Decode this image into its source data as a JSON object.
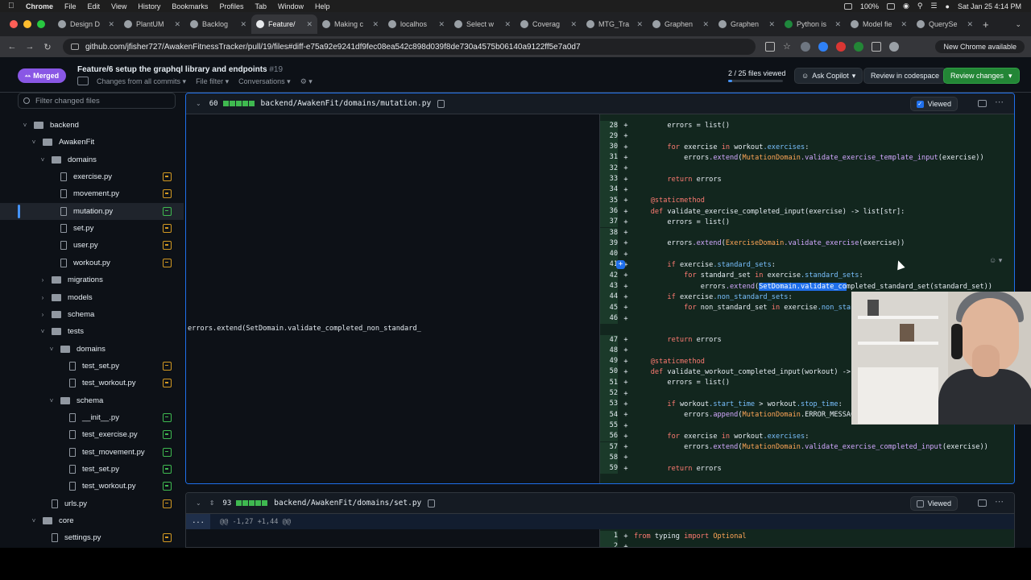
{
  "menubar": {
    "app": "Chrome",
    "items": [
      "File",
      "Edit",
      "View",
      "History",
      "Bookmarks",
      "Profiles",
      "Tab",
      "Window",
      "Help"
    ],
    "battery": "100%",
    "datetime": "Sat Jan 25  4:14 PM"
  },
  "tabs": [
    {
      "label": "Design D",
      "active": false
    },
    {
      "label": "PlantUM",
      "active": false
    },
    {
      "label": "Backlog",
      "active": false
    },
    {
      "label": "Feature/",
      "active": true
    },
    {
      "label": "Making c",
      "active": false
    },
    {
      "label": "localhos",
      "active": false
    },
    {
      "label": "Select w",
      "active": false
    },
    {
      "label": "Coverag",
      "active": false
    },
    {
      "label": "MTG_Tra",
      "active": false
    },
    {
      "label": "Graphen",
      "active": false
    },
    {
      "label": "Graphen",
      "active": false
    },
    {
      "label": "Python is",
      "active": false
    },
    {
      "label": "Model fie",
      "active": false
    },
    {
      "label": "QuerySe",
      "active": false
    }
  ],
  "address": {
    "url": "github.com/jfisher727/AwakenFitnessTracker/pull/19/files#diff-e75a92e9241df9fec08ea542c898d039f8de730a4575b06140a9122ff5e7a0d7",
    "new_chrome": "New Chrome available"
  },
  "pr": {
    "status": "Merged",
    "title": "Feature/6 setup the graphql library and endpoints",
    "number": "#19",
    "changes_filter": "Changes from all commits",
    "file_filter": "File filter",
    "conversations": "Conversations",
    "files_viewed": "2 / 25 files viewed",
    "files_viewed_fraction": 0.08,
    "ask_copilot": "Ask Copilot",
    "review_codespace": "Review in codespace",
    "review_changes": "Review changes"
  },
  "tree": {
    "filter_placeholder": "Filter changed files",
    "rows": [
      {
        "label": "backend",
        "type": "folder",
        "depth": 0,
        "expanded": true
      },
      {
        "label": "AwakenFit",
        "type": "folder",
        "depth": 1,
        "expanded": true
      },
      {
        "label": "domains",
        "type": "folder",
        "depth": 2,
        "expanded": true
      },
      {
        "label": "exercise.py",
        "type": "file",
        "depth": 3,
        "status": "modified"
      },
      {
        "label": "movement.py",
        "type": "file",
        "depth": 3,
        "status": "modified"
      },
      {
        "label": "mutation.py",
        "type": "file",
        "depth": 3,
        "status": "added",
        "selected": true
      },
      {
        "label": "set.py",
        "type": "file",
        "depth": 3,
        "status": "modified"
      },
      {
        "label": "user.py",
        "type": "file",
        "depth": 3,
        "status": "modified"
      },
      {
        "label": "workout.py",
        "type": "file",
        "depth": 3,
        "status": "modified"
      },
      {
        "label": "migrations",
        "type": "folder",
        "depth": 2,
        "expanded": false
      },
      {
        "label": "models",
        "type": "folder",
        "depth": 2,
        "expanded": false
      },
      {
        "label": "schema",
        "type": "folder",
        "depth": 2,
        "expanded": false
      },
      {
        "label": "tests",
        "type": "folder",
        "depth": 2,
        "expanded": true
      },
      {
        "label": "domains",
        "type": "folder",
        "depth": 3,
        "expanded": true
      },
      {
        "label": "test_set.py",
        "type": "file",
        "depth": 4,
        "status": "modified"
      },
      {
        "label": "test_workout.py",
        "type": "file",
        "depth": 4,
        "status": "modified"
      },
      {
        "label": "schema",
        "type": "folder",
        "depth": 3,
        "expanded": true
      },
      {
        "label": "__init__.py",
        "type": "file",
        "depth": 4,
        "status": "added"
      },
      {
        "label": "test_exercise.py",
        "type": "file",
        "depth": 4,
        "status": "added"
      },
      {
        "label": "test_movement.py",
        "type": "file",
        "depth": 4,
        "status": "added"
      },
      {
        "label": "test_set.py",
        "type": "file",
        "depth": 4,
        "status": "added"
      },
      {
        "label": "test_workout.py",
        "type": "file",
        "depth": 4,
        "status": "added"
      },
      {
        "label": "urls.py",
        "type": "file",
        "depth": 2,
        "status": "modified"
      },
      {
        "label": "core",
        "type": "folder",
        "depth": 1,
        "expanded": true
      },
      {
        "label": "settings.py",
        "type": "file",
        "depth": 2,
        "status": "modified"
      }
    ]
  },
  "file1": {
    "count": "60",
    "path": "backend/AwakenFit/domains/mutation.py",
    "viewed_label": "Viewed",
    "lines": [
      {
        "n": "28",
        "code": "        errors = list()"
      },
      {
        "n": "29",
        "code": ""
      },
      {
        "n": "30",
        "code": "        for exercise in workout.exercises:"
      },
      {
        "n": "31",
        "code": "            errors.extend(MutationDomain.validate_exercise_template_input(exercise))"
      },
      {
        "n": "32",
        "code": ""
      },
      {
        "n": "33",
        "code": "        return errors"
      },
      {
        "n": "34",
        "code": ""
      },
      {
        "n": "35",
        "code": "    @staticmethod"
      },
      {
        "n": "36",
        "code": "    def validate_exercise_completed_input(exercise) -> list[str]:"
      },
      {
        "n": "37",
        "code": "        errors = list()"
      },
      {
        "n": "38",
        "code": ""
      },
      {
        "n": "39",
        "code": "        errors.extend(ExerciseDomain.validate_exercise(exercise))"
      },
      {
        "n": "40",
        "code": ""
      },
      {
        "n": "41",
        "code": "        if exercise.standard_sets:"
      },
      {
        "n": "42",
        "code": "            for standard_set in exercise.standard_sets:"
      },
      {
        "n": "43",
        "code": "                errors.extend(SetDomain.validate_completed_standard_set(standard_set))"
      },
      {
        "n": "44",
        "code": "        if exercise.non_standard_sets:"
      },
      {
        "n": "45",
        "code": "            for non_standard_set in exercise.non_standard"
      },
      {
        "n": "46",
        "code": ""
      },
      {
        "n": "47",
        "code": "        return errors"
      },
      {
        "n": "48",
        "code": ""
      },
      {
        "n": "49",
        "code": "    @staticmethod"
      },
      {
        "n": "50",
        "code": "    def validate_workout_completed_input(workout) -> list"
      },
      {
        "n": "51",
        "code": "        errors = list()"
      },
      {
        "n": "52",
        "code": ""
      },
      {
        "n": "53",
        "code": "        if workout.start_time > workout.stop_time:"
      },
      {
        "n": "54",
        "code": "            errors.append(MutationDomain.ERROR_MESSAGES["
      },
      {
        "n": "55",
        "code": ""
      },
      {
        "n": "56",
        "code": "        for exercise in workout.exercises:"
      },
      {
        "n": "57",
        "code": "            errors.extend(MutationDomain.validate_exercise_completed_input(exercise))"
      },
      {
        "n": "58",
        "code": ""
      },
      {
        "n": "59",
        "code": "        return errors"
      }
    ],
    "wrapped_line": "errors.extend(SetDomain.validate_completed_non_standard_"
  },
  "file2": {
    "count": "93",
    "path": "backend/AwakenFit/domains/set.py",
    "viewed_label": "Viewed",
    "hunk": "@@ -1,27 +1,44 @@",
    "expand": "...",
    "lines": [
      {
        "n": "1",
        "code": "from typing import Optional"
      },
      {
        "n": "2",
        "code": ""
      }
    ]
  }
}
